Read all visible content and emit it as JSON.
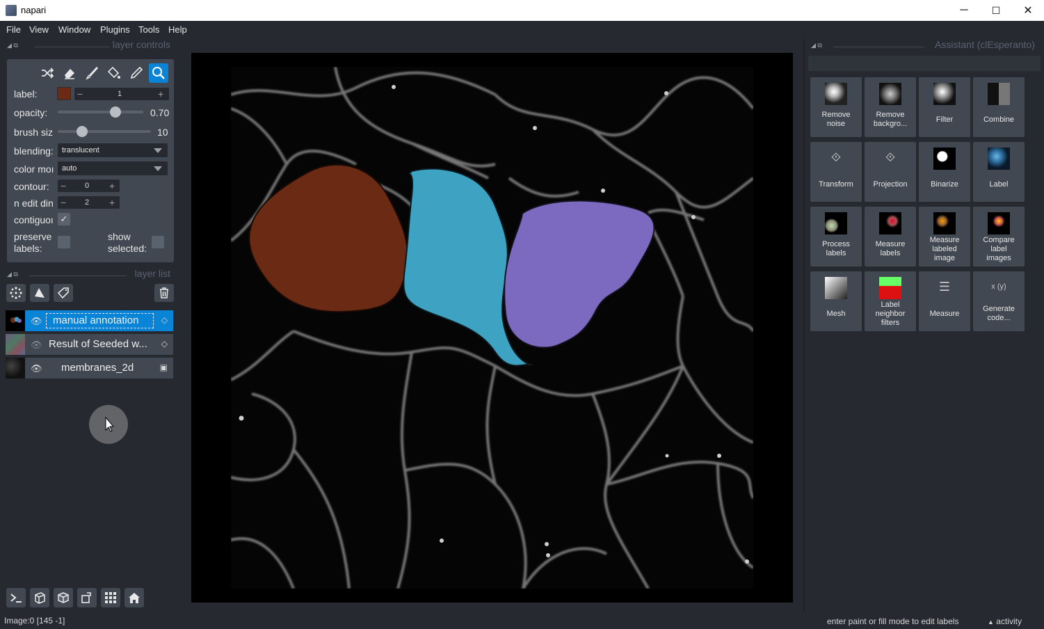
{
  "window": {
    "title": "napari",
    "minimize": "─",
    "maximize": "☐",
    "close": "✕"
  },
  "menubar": [
    "File",
    "View",
    "Window",
    "Plugins",
    "Tools",
    "Help"
  ],
  "layer_controls": {
    "header": "layer controls",
    "tools": [
      "shuffle-icon",
      "eraser-icon",
      "paintbrush-icon",
      "fill-bucket-icon",
      "color-picker-icon",
      "zoom-icon"
    ],
    "label": {
      "label": "label:",
      "value": "1",
      "color": "#6b2a13"
    },
    "opacity": {
      "label": "opacity:",
      "value": "0.70",
      "fraction": 0.7
    },
    "brush_size": {
      "label": "brush siz",
      "value": "10"
    },
    "blending": {
      "label": "blending:",
      "value": "translucent"
    },
    "color_mode": {
      "label": "color moı",
      "value": "auto"
    },
    "contour": {
      "label": "contour:",
      "value": "0"
    },
    "n_edit_dim": {
      "label": "n edit din",
      "value": "2"
    },
    "contiguous": {
      "label": "contiguoı",
      "checked": true
    },
    "preserve_labels": {
      "label1": "preserve",
      "label2": "labels:",
      "checked": false
    },
    "show_selected": {
      "label1": "show",
      "label2": "selected:",
      "checked": false
    }
  },
  "layer_list": {
    "header": "layer list",
    "layers": [
      {
        "name": "manual annotation",
        "visible": true,
        "type": "labels",
        "selected": true
      },
      {
        "name": "Result of Seeded w...",
        "visible": false,
        "type": "labels",
        "selected": false
      },
      {
        "name": "membranes_2d",
        "visible": true,
        "type": "image",
        "selected": false
      }
    ]
  },
  "assistant": {
    "header": "Assistant (clEsperanto)",
    "tiles": [
      {
        "label": "Remove noise",
        "lines": [
          "Remove",
          "noise"
        ]
      },
      {
        "label": "Remove background",
        "lines": [
          "Remove",
          "backgro..."
        ]
      },
      {
        "label": "Filter",
        "lines": [
          "Filter"
        ]
      },
      {
        "label": "Combine",
        "lines": [
          "Combine"
        ]
      },
      {
        "label": "Transform",
        "lines": [
          "Transform"
        ]
      },
      {
        "label": "Projection",
        "lines": [
          "Projection"
        ]
      },
      {
        "label": "Binarize",
        "lines": [
          "Binarize"
        ]
      },
      {
        "label": "Label",
        "lines": [
          "Label"
        ]
      },
      {
        "label": "Process labels",
        "lines": [
          "Process",
          "labels"
        ]
      },
      {
        "label": "Measure labels",
        "lines": [
          "Measure",
          "labels"
        ]
      },
      {
        "label": "Measure labeled image",
        "lines": [
          "Measure",
          "labeled",
          "image"
        ]
      },
      {
        "label": "Compare label images",
        "lines": [
          "Compare",
          "label",
          "images"
        ]
      },
      {
        "label": "Mesh",
        "lines": [
          "Mesh"
        ]
      },
      {
        "label": "Label neighbor filters",
        "lines": [
          "Label",
          "neighbor",
          "filters"
        ]
      },
      {
        "label": "Measure",
        "lines": [
          "Measure"
        ]
      },
      {
        "label": "Generate code",
        "lines": [
          "Generate",
          "code..."
        ]
      }
    ]
  },
  "status": {
    "left": "Image:0 [145  -1]",
    "right": "enter paint or fill mode to edit labels",
    "activity": "activity"
  },
  "colors": {
    "accent": "#0a84d6",
    "label1": "#6b2a13",
    "label2": "#3ea3c2",
    "label3": "#7b6ac0"
  }
}
